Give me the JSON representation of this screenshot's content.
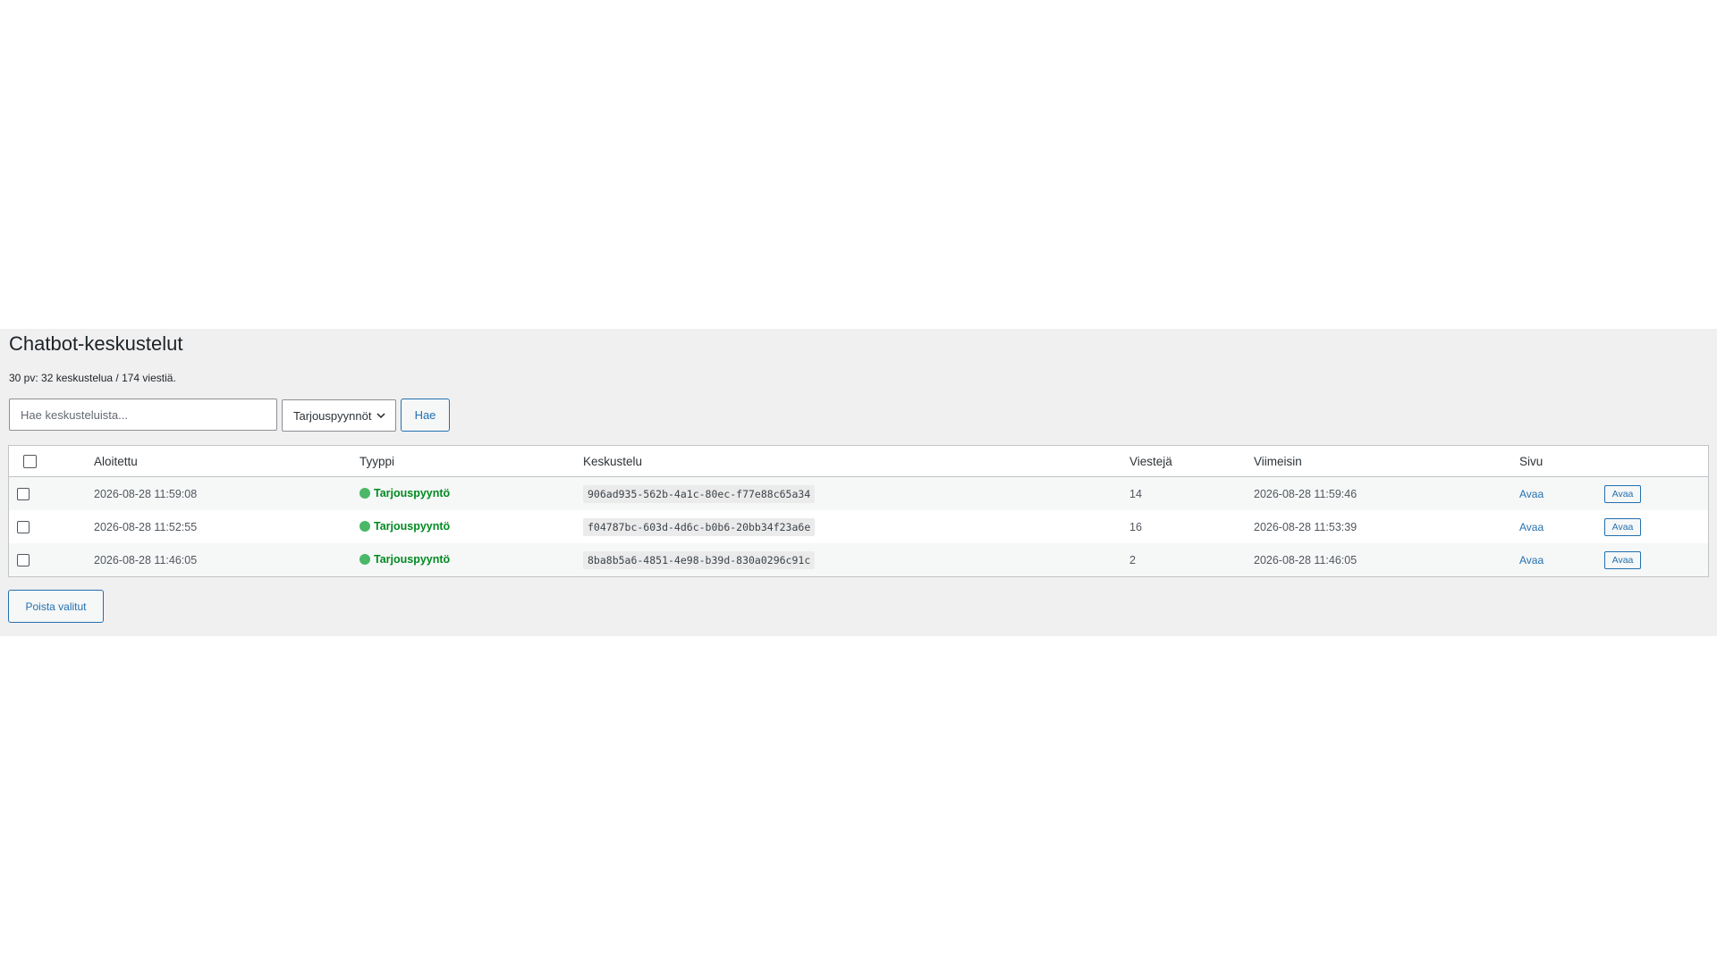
{
  "page": {
    "title": "Chatbot-keskustelut",
    "summary": "30 pv: 32 keskustelua / 174 viestiä."
  },
  "filters": {
    "search_placeholder": "Hae keskusteluista...",
    "search_value": "",
    "type_selected": "Tarjouspyynnöt",
    "search_button": "Hae"
  },
  "table": {
    "columns": {
      "started": "Aloitettu",
      "type": "Tyyppi",
      "conversation": "Keskustelu",
      "messages": "Viestejä",
      "latest": "Viimeisin",
      "page": "Sivu"
    },
    "rows": [
      {
        "started": "2026-08-28 11:59:08",
        "type": "Tarjouspyyntö",
        "conversation": "906ad935-562b-4a1c-80ec-f77e88c65a34",
        "messages": "14",
        "latest": "2026-08-28 11:59:46",
        "page_link": "Avaa",
        "open_button": "Avaa"
      },
      {
        "started": "2026-08-28 11:52:55",
        "type": "Tarjouspyyntö",
        "conversation": "f04787bc-603d-4d6c-b0b6-20bb34f23a6e",
        "messages": "16",
        "latest": "2026-08-28 11:53:39",
        "page_link": "Avaa",
        "open_button": "Avaa"
      },
      {
        "started": "2026-08-28 11:46:05",
        "type": "Tarjouspyyntö",
        "conversation": "8ba8b5a6-4851-4e98-b39d-830a0296c91c",
        "messages": "2",
        "latest": "2026-08-28 11:46:05",
        "page_link": "Avaa",
        "open_button": "Avaa"
      }
    ]
  },
  "actions": {
    "delete_selected": "Poista valitut"
  },
  "colors": {
    "accent": "#2271b1",
    "type_green": "#008a20",
    "status_dot": "#4ab866",
    "band_background": "#f0f0f1"
  },
  "icons": {
    "select_chevron": "chevron-down-icon",
    "type_status": "green-dot-icon"
  }
}
